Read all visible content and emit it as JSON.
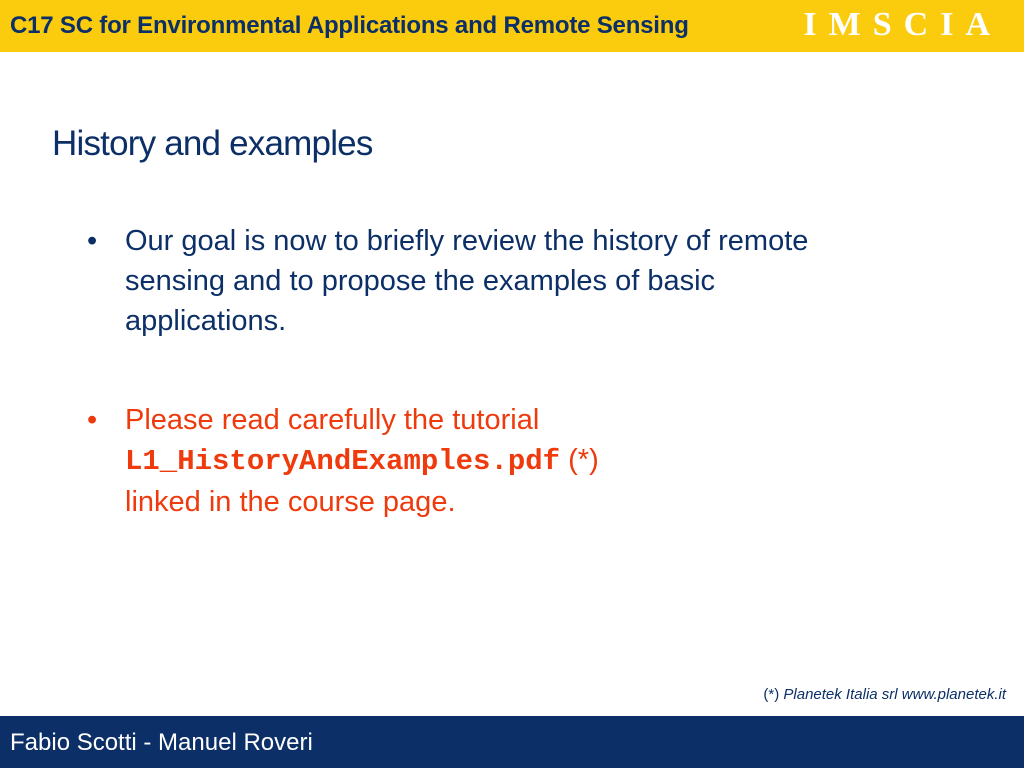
{
  "header": {
    "course_title": "C17 SC for Environmental Applications and Remote Sensing",
    "logo_text": "IMSCIA",
    "background_color": "#fbcb0d",
    "text_color": "#0b2f66"
  },
  "slide": {
    "title": "History and examples",
    "bullets": [
      {
        "lines": [
          "Our goal is now to briefly review the history of remote",
          "sensing and to propose the examples of basic",
          "applications."
        ],
        "color": "#0b2f66"
      },
      {
        "line1": "Please read carefully the tutorial",
        "filename": "L1_HistoryAndExamples.pdf",
        "footnote_marker": "(*)",
        "line3": "linked in the course page.",
        "color": "#ee3a0c"
      }
    ]
  },
  "footnote": {
    "marker": "(*)",
    "text": "Planetek Italia srl  www.planetek.it"
  },
  "footer": {
    "authors": "Fabio Scotti - Manuel Roveri",
    "background_color": "#0b2f66"
  }
}
